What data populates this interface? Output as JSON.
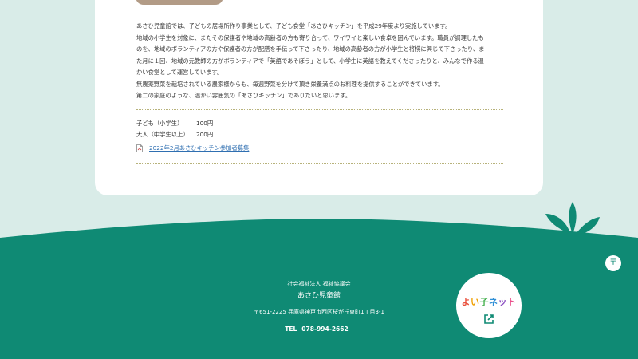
{
  "intro": {
    "paragraphs": [
      "あさひ児童館では、子どもの居場所作り事業として、子ども食堂「あさひキッチン」を平成29年度より実施しています。",
      "地域の小学生を対象に、またその保護者や地域の高齢者の方も寄り合って、ワイワイと楽しい食卓を囲んでいます。職員が調理したも",
      "のを、地域のボランティアの方や保護者の方が配膳を手伝って下さったり、地域の高齢者の方が小学生と将棋に興じて下さったり、ま",
      "た月に１回、地域の元教師の方がボランティアで「英語であそぼう」として、小学生に英語を教えてくださったりと、みんなで作る温",
      "かい食堂として運営しています。",
      "無農薬野菜を栽培されている農家様からも、毎週野菜を分けて頂き栄養満点のお料理を提供することができています。",
      "第二の家庭のような、温かい雰囲気の「あさひキッチン」でありたいと思います。"
    ]
  },
  "fees": [
    {
      "label": "子ども（小学生）",
      "price": "100円"
    },
    {
      "label": "大人（中学生以上）",
      "price": "200円"
    }
  ],
  "pdf_link": {
    "label": "2022年2月あさひキッチン参加者募集",
    "icon": "pdf-file-icon"
  },
  "footer": {
    "org": "社会福祉法人 福祉協議会",
    "center_name": "あさひ児童館",
    "address": "〒651-2225 兵庫県神戸市西区桜が丘東町1丁目3-1",
    "tel_label": "TEL",
    "tel_number": "078-994-2662",
    "bg_color": "#0f8a74"
  },
  "yoiko": {
    "label": "よい子ネット",
    "icon": "external-link-icon"
  },
  "page_top": {
    "label": "〒"
  }
}
